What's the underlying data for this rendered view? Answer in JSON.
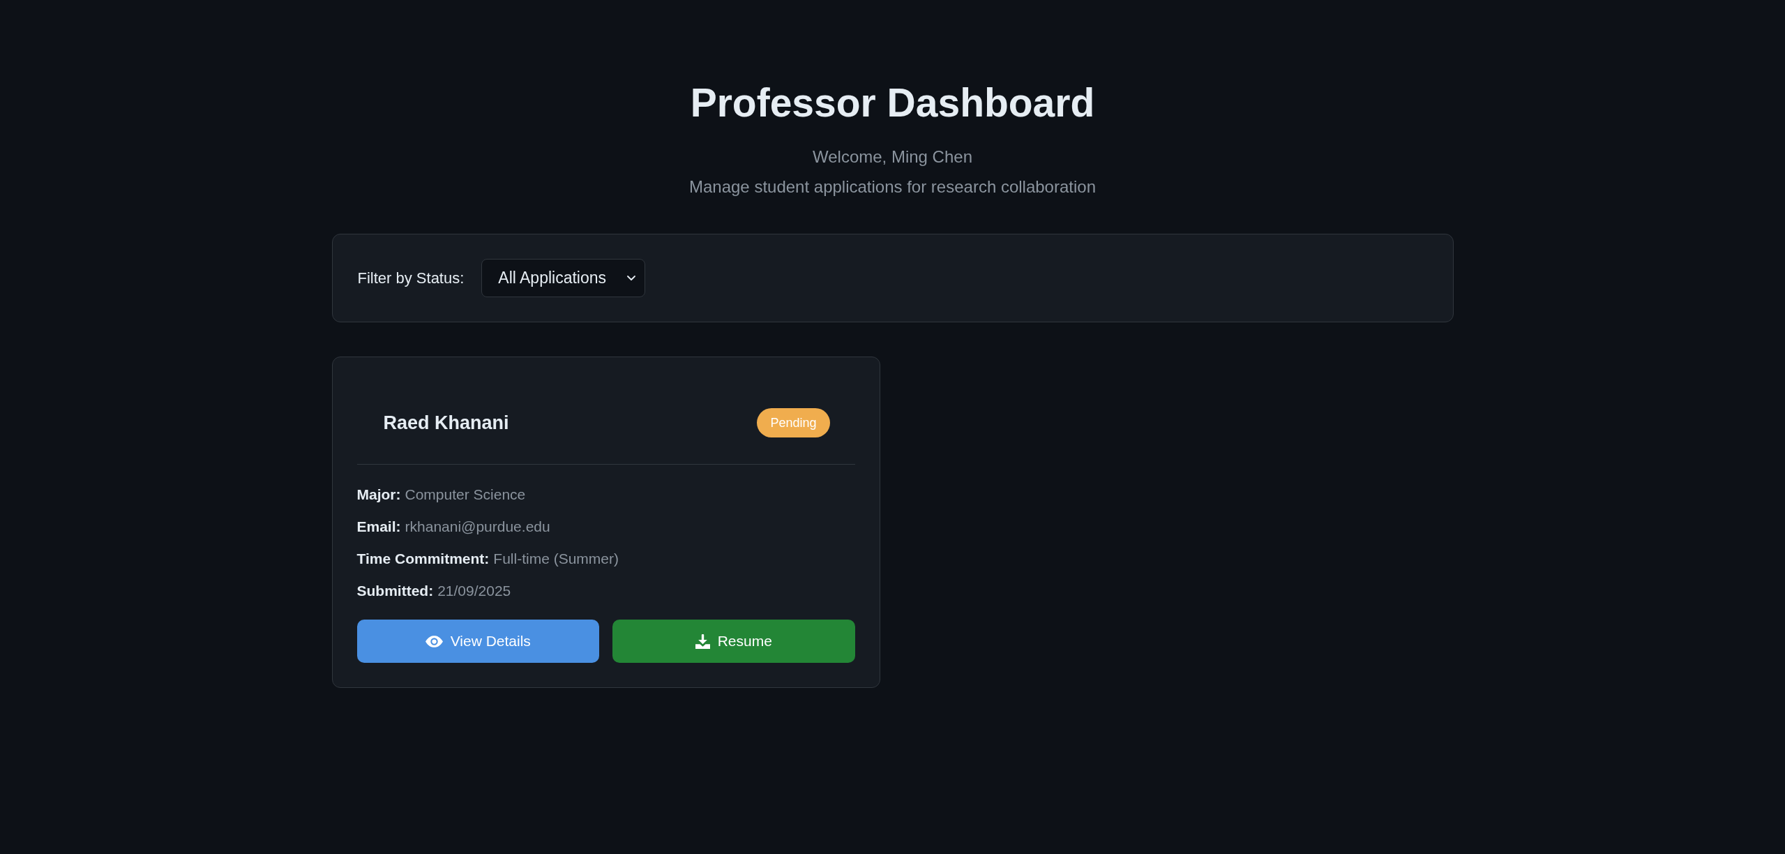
{
  "header": {
    "title": "Professor Dashboard",
    "welcome": "Welcome, Ming Chen",
    "subtitle": "Manage student applications for research collaboration"
  },
  "filter": {
    "label": "Filter by Status:",
    "value": "All Applications"
  },
  "applications": [
    {
      "name": "Raed Khanani",
      "status": {
        "label": "Pending",
        "color": "#f0ad4e"
      },
      "fields": [
        {
          "label": "Major:",
          "value": "Computer Science"
        },
        {
          "label": "Email:",
          "value": "rkhanani@purdue.edu"
        },
        {
          "label": "Time Commitment:",
          "value": "Full-time (Summer)"
        },
        {
          "label": "Submitted:",
          "value": "21/09/2025"
        }
      ],
      "actions": [
        {
          "kind": "view",
          "label": "View Details"
        },
        {
          "kind": "download",
          "label": "Resume"
        }
      ]
    }
  ]
}
